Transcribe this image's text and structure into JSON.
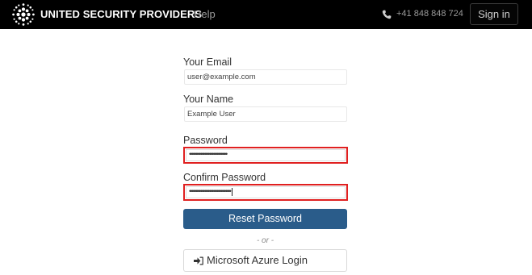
{
  "header": {
    "brand_name": "UNITED SECURITY PROVIDERS",
    "nav_help": "Help",
    "phone_number": "+41 848 848 724",
    "sign_in_label": "Sign in"
  },
  "form": {
    "email_label": "Your Email",
    "email_value": "user@example.com",
    "name_label": "Your Name",
    "name_value": "Example User",
    "password_label": "Password",
    "password_value": "••••••••••••••••••••••••••••••",
    "confirm_label": "Confirm Password",
    "confirm_value": "•••••••••••••••••••••••••••••••••",
    "reset_button_label": "Reset Password",
    "or_separator": "- or -",
    "azure_button_label": "Microsoft Azure Login"
  },
  "colors": {
    "navbar_bg": "#000000",
    "primary_button": "#2a5c8a",
    "error_border": "#e02020"
  },
  "icons": {
    "logo": "dot-cluster-logo",
    "phone": "phone-icon",
    "login": "sign-in-arrow-icon"
  }
}
